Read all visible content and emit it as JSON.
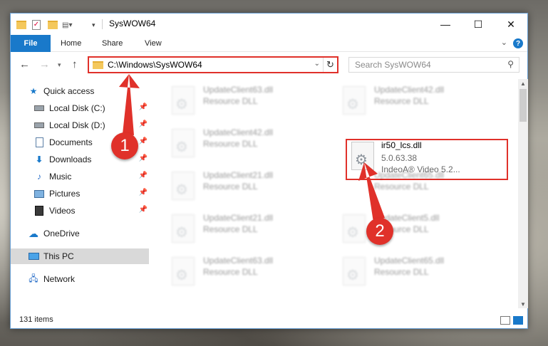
{
  "window": {
    "title": "SysWOW64"
  },
  "ribbon": {
    "file": "File",
    "home": "Home",
    "share": "Share",
    "view": "View",
    "help": "?"
  },
  "address": {
    "path": "C:\\Windows\\SysWOW64"
  },
  "search": {
    "placeholder": "Search SysWOW64"
  },
  "sidebar": {
    "items": [
      {
        "label": "Quick access",
        "icon": "star-icon"
      },
      {
        "label": "Local Disk (C:)",
        "icon": "drive-icon",
        "pinned": true
      },
      {
        "label": "Local Disk (D:)",
        "icon": "drive-icon",
        "pinned": true
      },
      {
        "label": "Documents",
        "icon": "documents-icon",
        "pinned": true
      },
      {
        "label": "Downloads",
        "icon": "download-icon",
        "pinned": true
      },
      {
        "label": "Music",
        "icon": "music-icon",
        "pinned": true
      },
      {
        "label": "Pictures",
        "icon": "pictures-icon",
        "pinned": true
      },
      {
        "label": "Videos",
        "icon": "videos-icon",
        "pinned": true
      },
      {
        "label": "OneDrive",
        "icon": "cloud-icon"
      },
      {
        "label": "This PC",
        "icon": "computer-icon",
        "selected": true
      },
      {
        "label": "Network",
        "icon": "network-icon"
      }
    ]
  },
  "files": [
    {
      "name": "UpdateClient63.dll",
      "type": "Resource DLL"
    },
    {
      "name": "UpdateClient42.dll",
      "type": "Resource DLL"
    },
    {
      "name": "UpdateClient42.dll",
      "type": "Resource DLL"
    },
    {
      "name": "ir50_lcs.dll",
      "version": "5.0.63.38",
      "description": "IndeoA® Video 5.2..."
    },
    {
      "name": "UpdateClient21.dll",
      "type": "Resource DLL"
    },
    {
      "name": "UpdateClient65.dll",
      "type": "Resource DLL"
    },
    {
      "name": "UpdateClient21.dll",
      "type": "Resource DLL"
    },
    {
      "name": "UpdateClient5.dll",
      "type": "Resource DLL"
    },
    {
      "name": "UpdateClient63.dll",
      "type": "Resource DLL"
    },
    {
      "name": "UpdateClient65.dll",
      "type": "Resource DLL"
    }
  ],
  "status": {
    "count": "131 items"
  },
  "annotations": {
    "marker1": "1",
    "marker2": "2",
    "color": "#e0312a"
  }
}
